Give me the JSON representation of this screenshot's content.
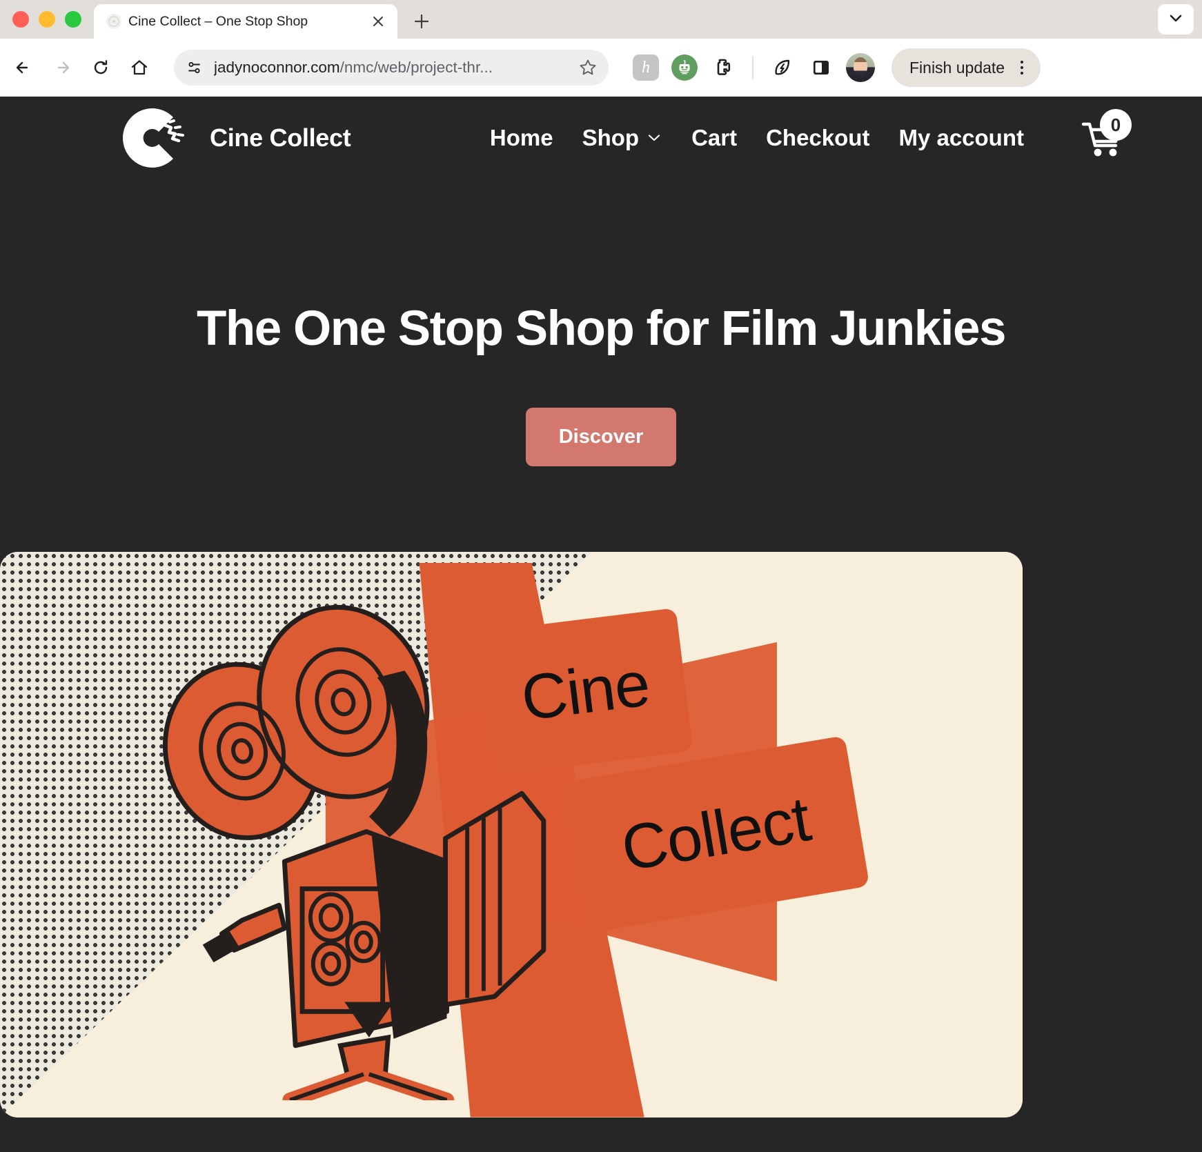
{
  "browser": {
    "tab": {
      "title": "Cine Collect – One Stop Shop",
      "favicon_icon": "site-favicon",
      "close_icon": "close-icon"
    },
    "new_tab_label": "+",
    "tab_list_icon": "chevron-down-icon",
    "toolbar": {
      "back_icon": "back-arrow-icon",
      "forward_icon": "forward-arrow-icon",
      "reload_icon": "reload-icon",
      "home_icon": "home-icon",
      "site_info_icon": "site-settings-icon",
      "url_domain": "jadynoconnor.com",
      "url_path": "/nmc/web/project-thr...",
      "url_full": "jadynoconnor.com/nmc/web/project-thr...",
      "bookmark_icon": "star-icon",
      "extensions": [
        {
          "name": "honey-extension-icon",
          "glyph": "h"
        },
        {
          "name": "robot-extension-icon",
          "glyph": ""
        },
        {
          "name": "extensions-puzzle-icon",
          "glyph": ""
        },
        {
          "name": "leaf-bolt-extension-icon",
          "glyph": ""
        },
        {
          "name": "side-panel-icon",
          "glyph": ""
        }
      ],
      "profile_icon": "profile-avatar",
      "update_button_label": "Finish update",
      "more_menu_icon": "three-dots-menu-icon"
    }
  },
  "site": {
    "brand": {
      "logo_icon": "cine-collect-projector-logo",
      "name": "Cine Collect"
    },
    "nav": [
      {
        "label": "Home",
        "has_dropdown": false
      },
      {
        "label": "Shop",
        "has_dropdown": true
      },
      {
        "label": "Cart",
        "has_dropdown": false
      },
      {
        "label": "Checkout",
        "has_dropdown": false
      },
      {
        "label": "My account",
        "has_dropdown": false
      }
    ],
    "cart": {
      "icon": "shopping-cart-icon",
      "count": "0"
    },
    "hero": {
      "title": "The One Stop Shop for Film Junkies",
      "cta_label": "Discover",
      "figure": {
        "alt_name": "retro-film-projector-illustration",
        "card_one_text": "Cine",
        "card_two_text": "Collect"
      }
    },
    "colors": {
      "background": "#262626",
      "accent_orange": "#dd5b33",
      "cta_rose": "#d3786f",
      "cream": "#f7eedb",
      "text_on_dark": "#ffffff"
    }
  }
}
